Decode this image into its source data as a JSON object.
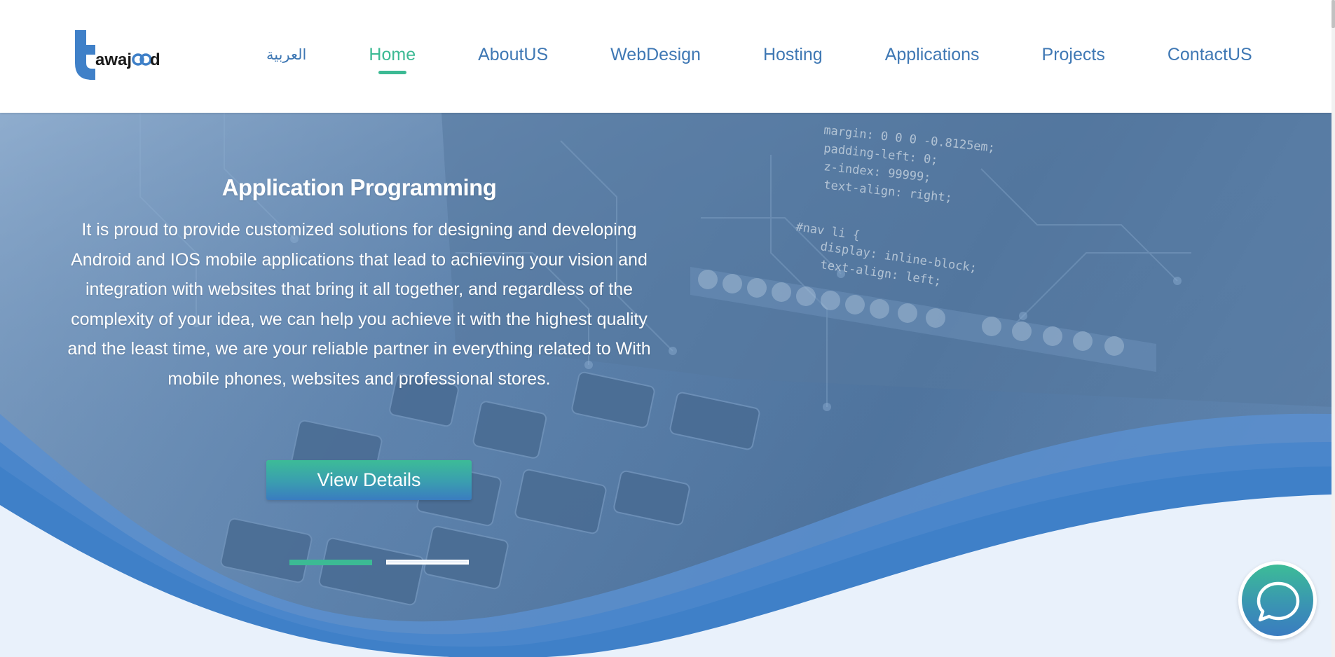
{
  "header": {
    "logo_text": "tawajood",
    "nav": [
      {
        "label": "العربية",
        "active": false
      },
      {
        "label": "Home",
        "active": true
      },
      {
        "label": "AboutUS",
        "active": false
      },
      {
        "label": "WebDesign",
        "active": false
      },
      {
        "label": "Hosting",
        "active": false
      },
      {
        "label": "Applications",
        "active": false
      },
      {
        "label": "Projects",
        "active": false
      },
      {
        "label": "ContactUS",
        "active": false
      }
    ]
  },
  "hero": {
    "title": "Application Programming",
    "description": "It is proud to provide customized solutions for designing and developing Android and IOS mobile applications that lead to achieving your vision and integration with websites that bring it all together, and regardless of the complexity of your idea, we can help you achieve it with the highest quality and the least time, we are your reliable partner in everything related to With mobile phones, websites and professional stores.",
    "button_label": "View Details",
    "slides": {
      "count": 2,
      "active_index": 0
    }
  },
  "chat": {
    "icon": "chat-bubble-icon"
  },
  "colors": {
    "brand_blue": "#3f78b4",
    "brand_green": "#3cba94",
    "hero_overlay": "#4f749e",
    "wave_blue": "#3f80c8",
    "wave_light": "#e8f0fa"
  }
}
